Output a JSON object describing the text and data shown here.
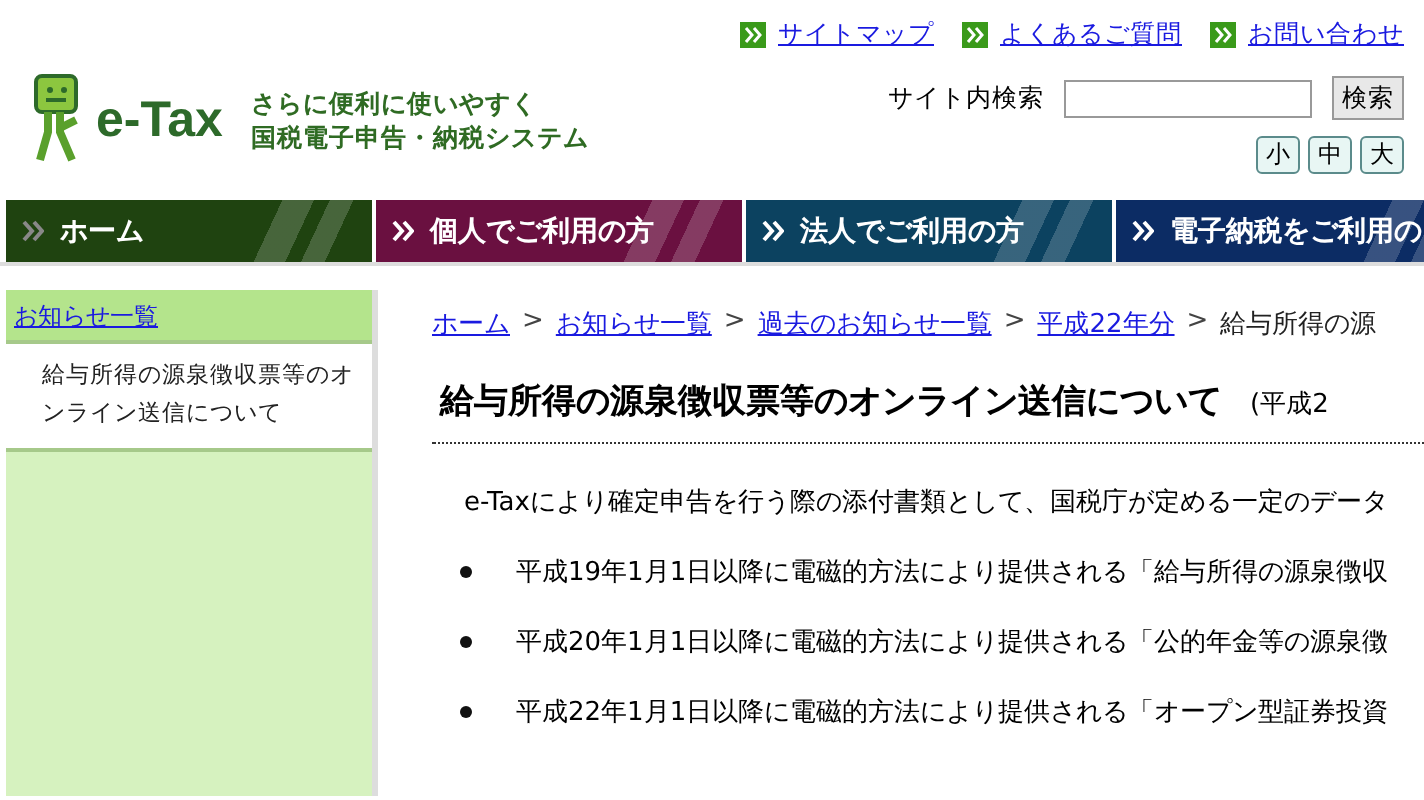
{
  "utility_links": [
    {
      "label": "サイトマップ"
    },
    {
      "label": "よくあるご質問"
    },
    {
      "label": "お問い合わせ"
    }
  ],
  "logo": {
    "name": "e-Tax",
    "tagline": [
      "さらに便利に使いやすく",
      "国税電子申告・納税システム"
    ]
  },
  "search": {
    "label": "サイト内検索",
    "button": "検索"
  },
  "font_sizes": [
    "小",
    "中",
    "大"
  ],
  "nav_tabs": [
    {
      "label": "ホーム",
      "selected": true,
      "color": "#1f4310"
    },
    {
      "label": "個人でご利用の方",
      "selected": false,
      "color": "#6a1040"
    },
    {
      "label": "法人でご利用の方",
      "selected": false,
      "color": "#0c4260"
    },
    {
      "label": "電子納税をご利用の",
      "selected": false,
      "color": "#0c2c64"
    }
  ],
  "sidebar": {
    "heading": "お知らせ一覧",
    "items": [
      {
        "label": "給与所得の源泉徴収票等のオンライン送信について",
        "selected": true
      }
    ]
  },
  "breadcrumb_separator": ">",
  "breadcrumb": [
    {
      "label": "ホーム",
      "link": true
    },
    {
      "label": "お知らせ一覧",
      "link": true
    },
    {
      "label": "過去のお知らせ一覧",
      "link": true
    },
    {
      "label": "平成22年分",
      "link": true
    },
    {
      "label": "給与所得の源",
      "link": false
    }
  ],
  "article": {
    "title": "給与所得の源泉徴収票等のオンライン送信について",
    "date": "(平成2",
    "intro": "e-Taxにより確定申告を行う際の添付書類として、国税庁が定める一定のデータ",
    "bullets": [
      "平成19年1月1日以降に電磁的方法により提供される「給与所得の源泉徴収",
      "平成20年1月1日以降に電磁的方法により提供される「公的年金等の源泉徴",
      "平成22年1月1日以降に電磁的方法により提供される「オープン型証券投資"
    ]
  }
}
